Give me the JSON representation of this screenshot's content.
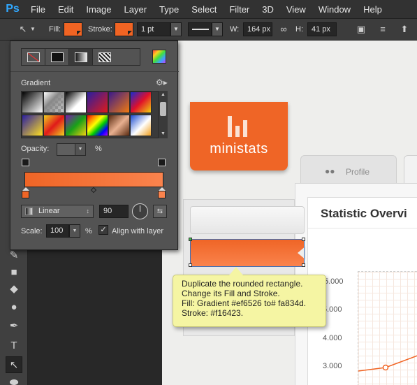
{
  "app": {
    "logo": "Ps"
  },
  "menu": [
    "File",
    "Edit",
    "Image",
    "Layer",
    "Type",
    "Select",
    "Filter",
    "3D",
    "View",
    "Window",
    "Help"
  ],
  "options_bar": {
    "fill_label": "Fill:",
    "stroke_label": "Stroke:",
    "stroke_width": "1 pt",
    "w_label": "W:",
    "w_value": "164 px",
    "h_label": "H:",
    "h_value": "41 px",
    "fill_color": "#f16423",
    "stroke_color": "#f16423"
  },
  "gradient_popup": {
    "section_title": "Gradient",
    "opacity_label": "Opacity:",
    "opacity_unit": "%",
    "gradient_type": "Linear",
    "angle": "90",
    "scale_label": "Scale:",
    "scale_value": "100",
    "scale_unit": "%",
    "align_label": "Align with layer",
    "align_checked": true,
    "gradient_start": "#ef6526",
    "gradient_end": "#fa834d"
  },
  "canvas": {
    "logo_text": "ministats",
    "tab_profile": "Profile",
    "stat_title": "Statistic Overvi",
    "y_axis": [
      "5.000",
      "5.000",
      "4.000",
      "3.000"
    ]
  },
  "tooltip": {
    "lines": [
      "Duplicate the rounded rectangle.",
      "Change its Fill and Stroke.",
      "Fill: Gradient #ef6526 to# fa834d.",
      "Stroke: #f16423."
    ]
  },
  "icons": {
    "tools": [
      "smudge-icon",
      "rectangle-shape-icon",
      "blur-drop-icon",
      "dodge-icon",
      "pen-icon",
      "type-icon",
      "path-selection-icon",
      "ellipse-icon"
    ]
  }
}
